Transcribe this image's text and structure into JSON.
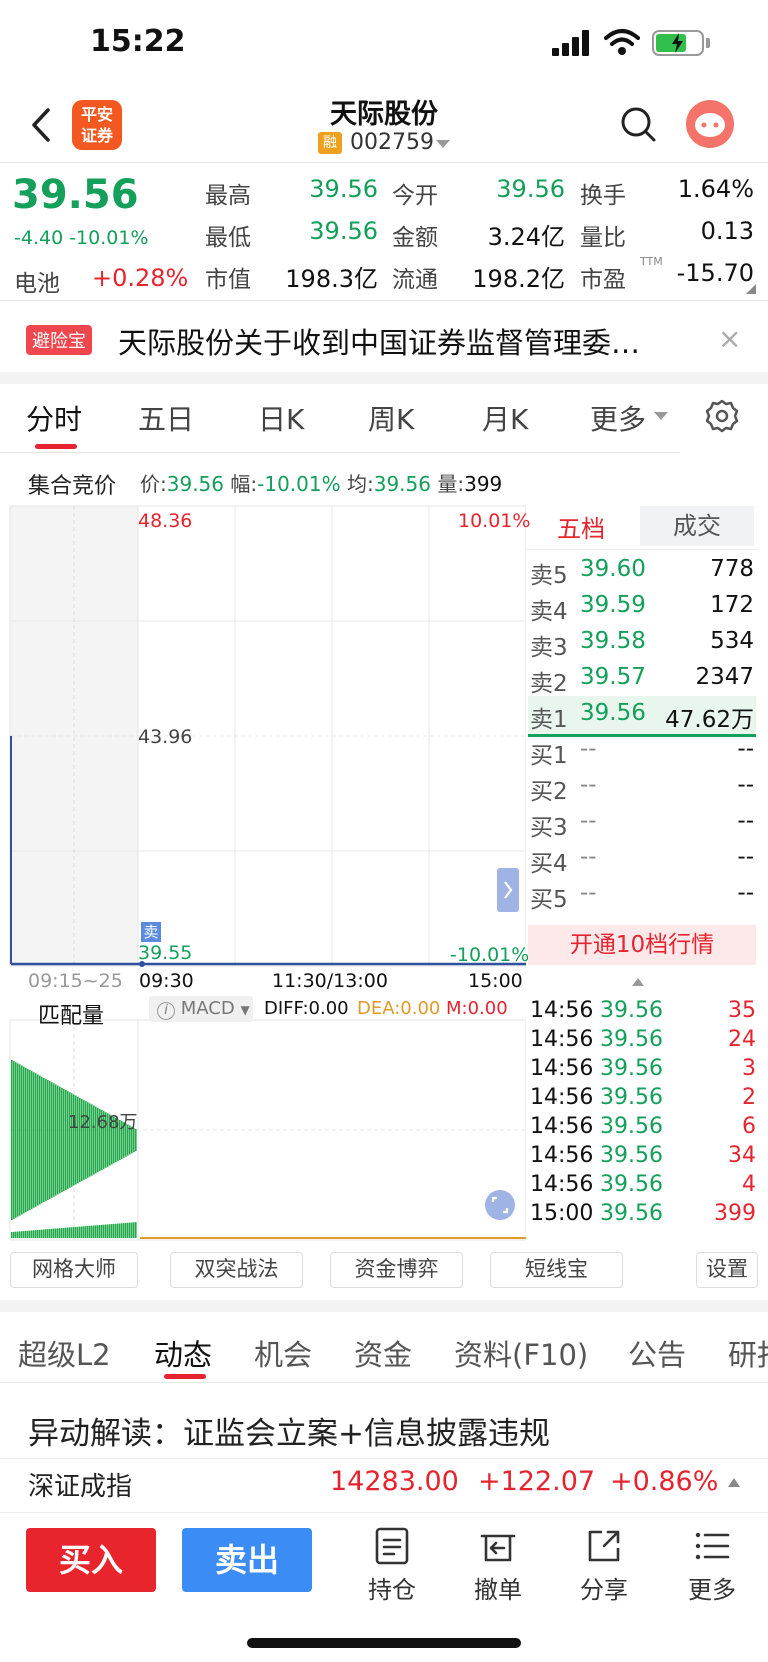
{
  "status_bar": {
    "time": "15:22"
  },
  "header": {
    "broker_logo": "平安\n证券",
    "stock_name": "天际股份",
    "margin_badge": "融",
    "stock_code": "002759"
  },
  "quote": {
    "price": "39.56",
    "change": "-4.40 -10.01%",
    "sector_label": "电池",
    "sector_change": "+0.28%",
    "cells": [
      {
        "label": "最高",
        "value": "39.56",
        "color": "green"
      },
      {
        "label": "今开",
        "value": "39.56",
        "color": "green"
      },
      {
        "label": "换手",
        "value": "1.64%",
        "color": "black"
      },
      {
        "label": "最低",
        "value": "39.56",
        "color": "green"
      },
      {
        "label": "金额",
        "value": "3.24亿",
        "color": "black"
      },
      {
        "label": "量比",
        "value": "0.13",
        "color": "black"
      },
      {
        "label": "市值",
        "value": "198.3亿",
        "color": "black"
      },
      {
        "label": "流通",
        "value": "198.2亿",
        "color": "black"
      },
      {
        "label": "市盈",
        "value": "-15.70",
        "color": "black"
      }
    ],
    "pe_superscript": "TTM"
  },
  "banner": {
    "badge": "避险宝",
    "text": "天际股份关于收到中国证券监督管理委…",
    "close": "×"
  },
  "period_tabs": [
    "分时",
    "五日",
    "日K",
    "周K",
    "月K",
    "更多"
  ],
  "info_strip": {
    "auction_label": "集合竞价",
    "price_label": "价:",
    "price": "39.56",
    "range_label": "幅:",
    "range": "-10.01%",
    "avg_label": "均:",
    "avg": "39.56",
    "vol_label": "量:",
    "vol": "399"
  },
  "chart": {
    "y_top": "48.36",
    "y_mid": "43.96",
    "y_bottom": "39.55",
    "pct_top": "10.01%",
    "pct_bottom": "-10.01%",
    "sell_marker": "卖",
    "x_pre": "09:15~25",
    "x_open": "09:30",
    "x_mid": "11:30/13:00",
    "x_close": "15:00",
    "match_vol_label": "匹配量",
    "match_vol_value": "12.68万",
    "indicator": "MACD",
    "indicator_info": "i",
    "diff": "DIFF:0.00",
    "dea": "DEA:0.00",
    "m": "M:0.00"
  },
  "order_book": {
    "tab_book": "五档",
    "tab_trades": "成交",
    "asks": [
      {
        "label": "卖5",
        "price": "39.60",
        "vol": "778"
      },
      {
        "label": "卖4",
        "price": "39.59",
        "vol": "172"
      },
      {
        "label": "卖3",
        "price": "39.58",
        "vol": "534"
      },
      {
        "label": "卖2",
        "price": "39.57",
        "vol": "2347"
      },
      {
        "label": "卖1",
        "price": "39.56",
        "vol": "47.62万"
      }
    ],
    "bids": [
      {
        "label": "买1",
        "price": "--",
        "vol": "--"
      },
      {
        "label": "买2",
        "price": "--",
        "vol": "--"
      },
      {
        "label": "买3",
        "price": "--",
        "vol": "--"
      },
      {
        "label": "买4",
        "price": "--",
        "vol": "--"
      },
      {
        "label": "买5",
        "price": "--",
        "vol": "--"
      }
    ],
    "open_level10": "开通10档行情"
  },
  "ticks": [
    {
      "time": "14:56",
      "price": "39.56",
      "vol": "35"
    },
    {
      "time": "14:56",
      "price": "39.56",
      "vol": "24"
    },
    {
      "time": "14:56",
      "price": "39.56",
      "vol": "3"
    },
    {
      "time": "14:56",
      "price": "39.56",
      "vol": "2"
    },
    {
      "time": "14:56",
      "price": "39.56",
      "vol": "6"
    },
    {
      "time": "14:56",
      "price": "39.56",
      "vol": "34"
    },
    {
      "time": "14:56",
      "price": "39.56",
      "vol": "4"
    },
    {
      "time": "15:00",
      "price": "39.56",
      "vol": "399"
    }
  ],
  "tools": [
    "网格大师",
    "双突战法",
    "资金博弈",
    "短线宝",
    "设置"
  ],
  "section_tabs": [
    "超级L2",
    "动态",
    "机会",
    "资金",
    "资料(F10)",
    "公告",
    "研报"
  ],
  "news_line": "异动解读：证监会立案+信息披露违规",
  "index_bar": {
    "name": "深证成指",
    "value": "14283.00",
    "change": "+122.07",
    "pct": "+0.86%"
  },
  "bottom_bar": {
    "buy": "买入",
    "sell": "卖出",
    "holdings": "持仓",
    "cancel": "撤单",
    "share": "分享",
    "more": "更多"
  },
  "colors": {
    "up": "#e6242f",
    "down": "#14a05a",
    "accent_orange": "#f2581f",
    "buy_button": "#e8242c",
    "sell_button": "#3b8cf4"
  }
}
